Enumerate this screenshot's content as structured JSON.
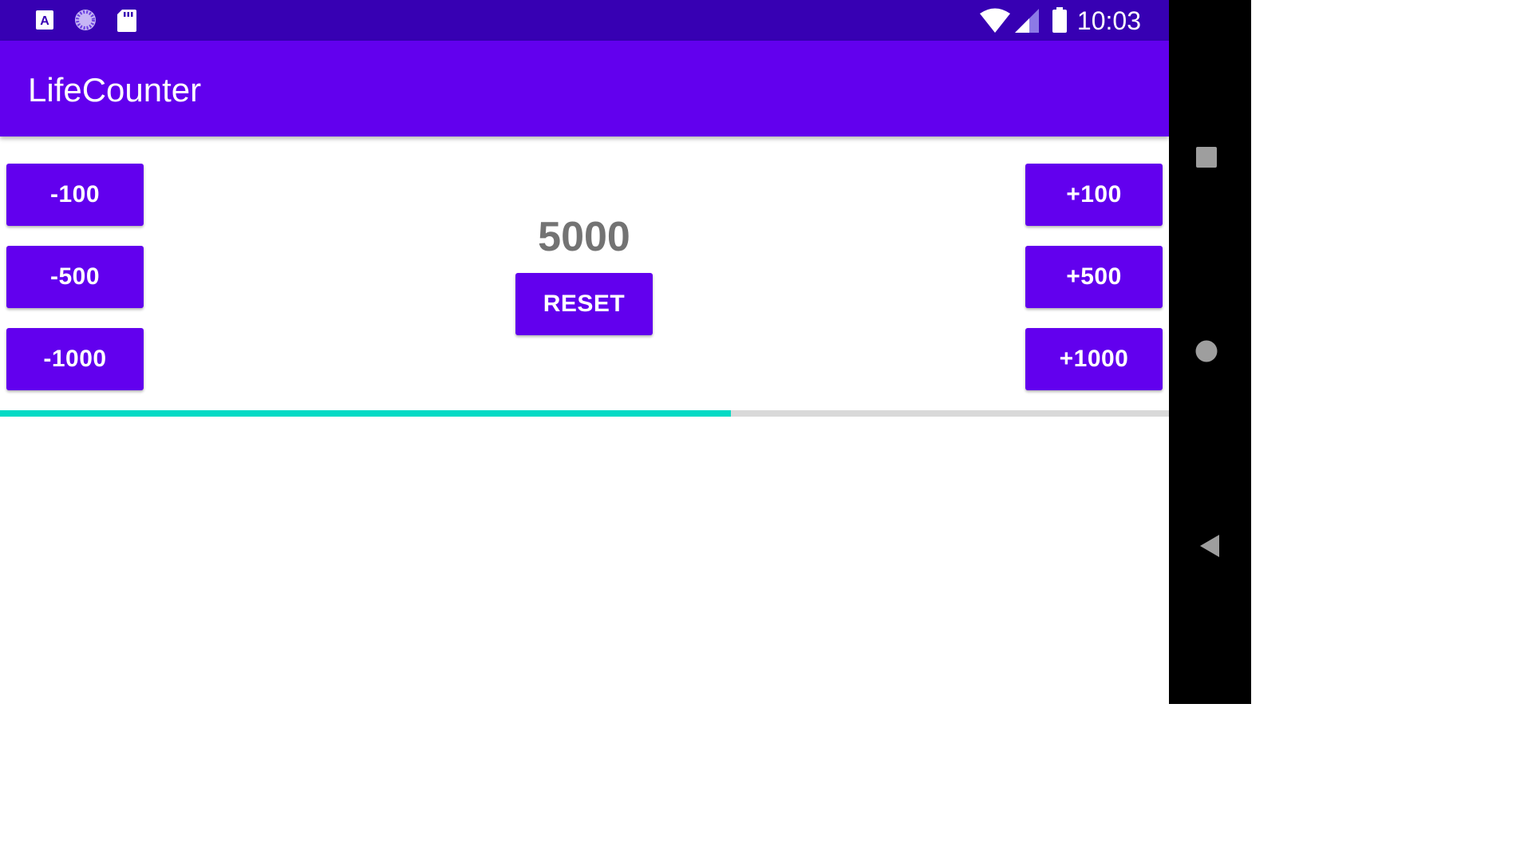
{
  "status_bar": {
    "time": "10:03",
    "icons_left": [
      "a-badge-icon",
      "loading-circle-icon",
      "sd-card-icon"
    ],
    "icons_right": [
      "wifi-icon",
      "cell-signal-icon",
      "battery-icon"
    ]
  },
  "app_bar": {
    "title": "LifeCounter"
  },
  "counter": {
    "value": "5000",
    "reset_label": "RESET"
  },
  "buttons": {
    "minus_100": "-100",
    "minus_500": "-500",
    "minus_1000": "-1000",
    "plus_100": "+100",
    "plus_500": "+500",
    "plus_1000": "+1000"
  },
  "progress": {
    "percent": 62.5
  },
  "nav_bar": {
    "buttons": [
      "recents-icon",
      "home-icon",
      "back-icon"
    ]
  },
  "colors": {
    "status_bar": "#3700b3",
    "primary": "#6200ee",
    "accent": "#03dac5",
    "track": "#d9d9d9",
    "counter_text": "#737373"
  }
}
